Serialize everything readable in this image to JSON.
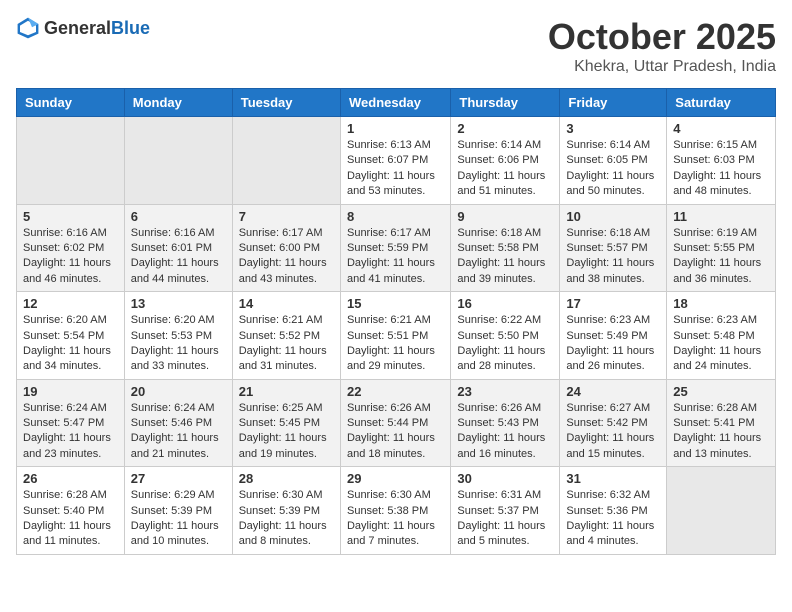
{
  "header": {
    "logo_general": "General",
    "logo_blue": "Blue",
    "month_title": "October 2025",
    "location": "Khekra, Uttar Pradesh, India"
  },
  "weekdays": [
    "Sunday",
    "Monday",
    "Tuesday",
    "Wednesday",
    "Thursday",
    "Friday",
    "Saturday"
  ],
  "weeks": [
    [
      {
        "day": "",
        "content": ""
      },
      {
        "day": "",
        "content": ""
      },
      {
        "day": "",
        "content": ""
      },
      {
        "day": "1",
        "content": "Sunrise: 6:13 AM\nSunset: 6:07 PM\nDaylight: 11 hours\nand 53 minutes."
      },
      {
        "day": "2",
        "content": "Sunrise: 6:14 AM\nSunset: 6:06 PM\nDaylight: 11 hours\nand 51 minutes."
      },
      {
        "day": "3",
        "content": "Sunrise: 6:14 AM\nSunset: 6:05 PM\nDaylight: 11 hours\nand 50 minutes."
      },
      {
        "day": "4",
        "content": "Sunrise: 6:15 AM\nSunset: 6:03 PM\nDaylight: 11 hours\nand 48 minutes."
      }
    ],
    [
      {
        "day": "5",
        "content": "Sunrise: 6:16 AM\nSunset: 6:02 PM\nDaylight: 11 hours\nand 46 minutes."
      },
      {
        "day": "6",
        "content": "Sunrise: 6:16 AM\nSunset: 6:01 PM\nDaylight: 11 hours\nand 44 minutes."
      },
      {
        "day": "7",
        "content": "Sunrise: 6:17 AM\nSunset: 6:00 PM\nDaylight: 11 hours\nand 43 minutes."
      },
      {
        "day": "8",
        "content": "Sunrise: 6:17 AM\nSunset: 5:59 PM\nDaylight: 11 hours\nand 41 minutes."
      },
      {
        "day": "9",
        "content": "Sunrise: 6:18 AM\nSunset: 5:58 PM\nDaylight: 11 hours\nand 39 minutes."
      },
      {
        "day": "10",
        "content": "Sunrise: 6:18 AM\nSunset: 5:57 PM\nDaylight: 11 hours\nand 38 minutes."
      },
      {
        "day": "11",
        "content": "Sunrise: 6:19 AM\nSunset: 5:55 PM\nDaylight: 11 hours\nand 36 minutes."
      }
    ],
    [
      {
        "day": "12",
        "content": "Sunrise: 6:20 AM\nSunset: 5:54 PM\nDaylight: 11 hours\nand 34 minutes."
      },
      {
        "day": "13",
        "content": "Sunrise: 6:20 AM\nSunset: 5:53 PM\nDaylight: 11 hours\nand 33 minutes."
      },
      {
        "day": "14",
        "content": "Sunrise: 6:21 AM\nSunset: 5:52 PM\nDaylight: 11 hours\nand 31 minutes."
      },
      {
        "day": "15",
        "content": "Sunrise: 6:21 AM\nSunset: 5:51 PM\nDaylight: 11 hours\nand 29 minutes."
      },
      {
        "day": "16",
        "content": "Sunrise: 6:22 AM\nSunset: 5:50 PM\nDaylight: 11 hours\nand 28 minutes."
      },
      {
        "day": "17",
        "content": "Sunrise: 6:23 AM\nSunset: 5:49 PM\nDaylight: 11 hours\nand 26 minutes."
      },
      {
        "day": "18",
        "content": "Sunrise: 6:23 AM\nSunset: 5:48 PM\nDaylight: 11 hours\nand 24 minutes."
      }
    ],
    [
      {
        "day": "19",
        "content": "Sunrise: 6:24 AM\nSunset: 5:47 PM\nDaylight: 11 hours\nand 23 minutes."
      },
      {
        "day": "20",
        "content": "Sunrise: 6:24 AM\nSunset: 5:46 PM\nDaylight: 11 hours\nand 21 minutes."
      },
      {
        "day": "21",
        "content": "Sunrise: 6:25 AM\nSunset: 5:45 PM\nDaylight: 11 hours\nand 19 minutes."
      },
      {
        "day": "22",
        "content": "Sunrise: 6:26 AM\nSunset: 5:44 PM\nDaylight: 11 hours\nand 18 minutes."
      },
      {
        "day": "23",
        "content": "Sunrise: 6:26 AM\nSunset: 5:43 PM\nDaylight: 11 hours\nand 16 minutes."
      },
      {
        "day": "24",
        "content": "Sunrise: 6:27 AM\nSunset: 5:42 PM\nDaylight: 11 hours\nand 15 minutes."
      },
      {
        "day": "25",
        "content": "Sunrise: 6:28 AM\nSunset: 5:41 PM\nDaylight: 11 hours\nand 13 minutes."
      }
    ],
    [
      {
        "day": "26",
        "content": "Sunrise: 6:28 AM\nSunset: 5:40 PM\nDaylight: 11 hours\nand 11 minutes."
      },
      {
        "day": "27",
        "content": "Sunrise: 6:29 AM\nSunset: 5:39 PM\nDaylight: 11 hours\nand 10 minutes."
      },
      {
        "day": "28",
        "content": "Sunrise: 6:30 AM\nSunset: 5:39 PM\nDaylight: 11 hours\nand 8 minutes."
      },
      {
        "day": "29",
        "content": "Sunrise: 6:30 AM\nSunset: 5:38 PM\nDaylight: 11 hours\nand 7 minutes."
      },
      {
        "day": "30",
        "content": "Sunrise: 6:31 AM\nSunset: 5:37 PM\nDaylight: 11 hours\nand 5 minutes."
      },
      {
        "day": "31",
        "content": "Sunrise: 6:32 AM\nSunset: 5:36 PM\nDaylight: 11 hours\nand 4 minutes."
      },
      {
        "day": "",
        "content": ""
      }
    ]
  ]
}
